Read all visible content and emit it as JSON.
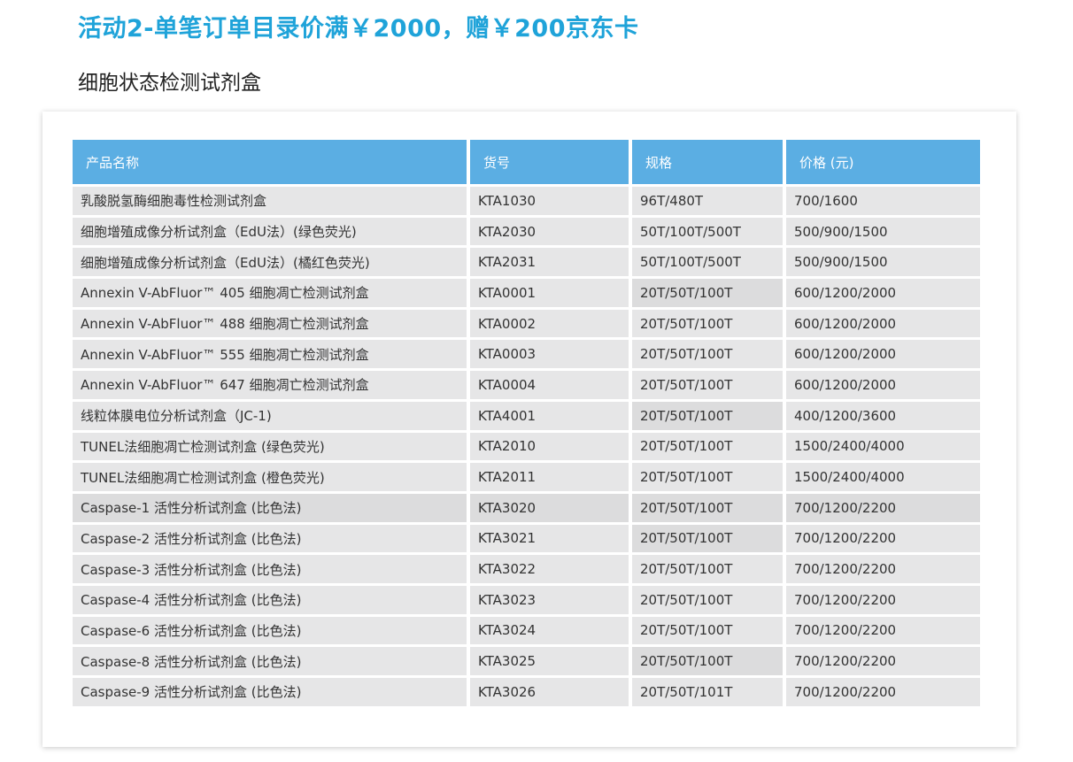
{
  "promo": {
    "title": "活动2-单笔订单目录价满￥2000，赠￥200京东卡"
  },
  "section": {
    "title": "细胞状态检测试剂盒"
  },
  "table": {
    "headers": [
      "产品名称",
      "货号",
      "规格",
      "价格 (元)"
    ],
    "rows": [
      [
        "乳酸脱氢酶细胞毒性检测试剂盒",
        "KTA1030",
        "96T/480T",
        "700/1600"
      ],
      [
        "细胞增殖成像分析试剂盒（EdU法）(绿色荧光)",
        "KTA2030",
        "50T/100T/500T",
        "500/900/1500"
      ],
      [
        "细胞增殖成像分析试剂盒（EdU法）(橘红色荧光)",
        "KTA2031",
        "50T/100T/500T",
        "500/900/1500"
      ],
      [
        "Annexin V-AbFluor™ 405 细胞凋亡检测试剂盒",
        "KTA0001",
        "20T/50T/100T",
        "600/1200/2000"
      ],
      [
        "Annexin V-AbFluor™ 488 细胞凋亡检测试剂盒",
        "KTA0002",
        "20T/50T/100T",
        "600/1200/2000"
      ],
      [
        "Annexin V-AbFluor™ 555 细胞凋亡检测试剂盒",
        "KTA0003",
        "20T/50T/100T",
        "600/1200/2000"
      ],
      [
        "Annexin V-AbFluor™ 647 细胞凋亡检测试剂盒",
        "KTA0004",
        "20T/50T/100T",
        "600/1200/2000"
      ],
      [
        "线粒体膜电位分析试剂盒（JC-1)",
        "KTA4001",
        "20T/50T/100T",
        "400/1200/3600"
      ],
      [
        "TUNEL法细胞凋亡检测试剂盒 (绿色荧光)",
        "KTA2010",
        "20T/50T/100T",
        "1500/2400/4000"
      ],
      [
        "TUNEL法细胞凋亡检测试剂盒 (橙色荧光)",
        "KTA2011",
        "20T/50T/100T",
        "1500/2400/4000"
      ],
      [
        "Caspase-1 活性分析试剂盒 (比色法)",
        "KTA3020",
        "20T/50T/100T",
        "700/1200/2200"
      ],
      [
        "Caspase-2 活性分析试剂盒 (比色法)",
        "KTA3021",
        "20T/50T/100T",
        "700/1200/2200"
      ],
      [
        "Caspase-3 活性分析试剂盒 (比色法)",
        "KTA3022",
        "20T/50T/100T",
        "700/1200/2200"
      ],
      [
        "Caspase-4 活性分析试剂盒 (比色法)",
        "KTA3023",
        "20T/50T/100T",
        "700/1200/2200"
      ],
      [
        "Caspase-6 活性分析试剂盒 (比色法)",
        "KTA3024",
        "20T/50T/100T",
        "700/1200/2200"
      ],
      [
        "Caspase-8 活性分析试剂盒 (比色法)",
        "KTA3025",
        "20T/50T/100T",
        "700/1200/2200"
      ],
      [
        "Caspase-9 活性分析试剂盒 (比色法)",
        "KTA3026",
        "20T/50T/101T",
        "700/1200/2200"
      ]
    ]
  },
  "colors": {
    "promo_title": "#1fa3d9",
    "header_bg": "#5baee3",
    "header_text": "#ffffff",
    "row_bg": "#e6e6e7"
  }
}
